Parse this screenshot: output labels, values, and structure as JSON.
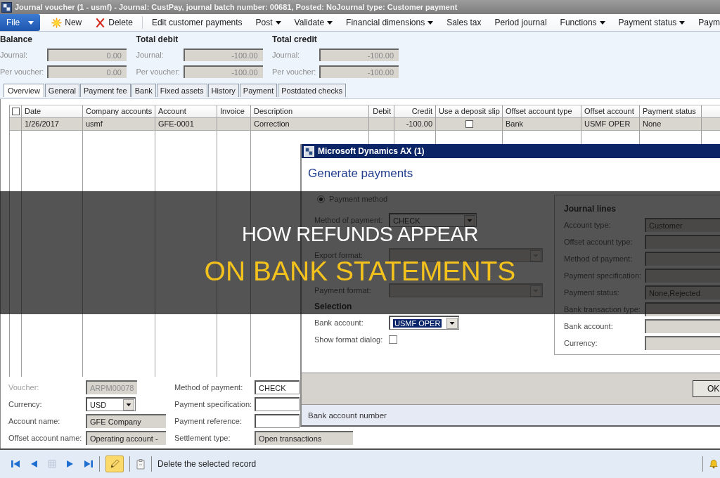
{
  "window": {
    "title": "Journal voucher (1 - usmf) - Journal: CustPay, journal batch number: 00681, Posted: NoJournal type: Customer payment"
  },
  "toolbar": [
    {
      "kind": "file",
      "label": "File"
    },
    {
      "kind": "new",
      "label": "New"
    },
    {
      "kind": "delete",
      "label": "Delete"
    },
    {
      "kind": "plain",
      "label": "Edit customer payments"
    },
    {
      "kind": "menu",
      "label": "Post"
    },
    {
      "kind": "menu",
      "label": "Validate"
    },
    {
      "kind": "menu",
      "label": "Financial dimensions"
    },
    {
      "kind": "plain",
      "label": "Sales tax"
    },
    {
      "kind": "plain",
      "label": "Period journal"
    },
    {
      "kind": "menu",
      "label": "Functions"
    },
    {
      "kind": "menu",
      "label": "Payment status"
    },
    {
      "kind": "plain",
      "label": "Paym"
    }
  ],
  "totals": [
    {
      "heading": "Balance",
      "rows": [
        {
          "label": "Journal:",
          "value": "0.00"
        },
        {
          "label": "Per voucher:",
          "value": "0.00"
        }
      ]
    },
    {
      "heading": "Total debit",
      "rows": [
        {
          "label": "Journal:",
          "value": "-100.00"
        },
        {
          "label": "Per voucher:",
          "value": "-100.00"
        }
      ]
    },
    {
      "heading": "Total credit",
      "rows": [
        {
          "label": "Journal:",
          "value": "-100.00"
        },
        {
          "label": "Per voucher:",
          "value": "-100.00"
        }
      ]
    }
  ],
  "tabs": [
    {
      "label": "Overview",
      "selected": true
    },
    {
      "label": "General",
      "selected": false
    },
    {
      "label": "Payment fee",
      "selected": false
    },
    {
      "label": "Bank",
      "selected": false
    },
    {
      "label": "Fixed assets",
      "selected": false
    },
    {
      "label": "History",
      "selected": false
    },
    {
      "label": "Payment",
      "selected": false
    },
    {
      "label": "Postdated checks",
      "selected": false
    }
  ],
  "grid": {
    "select_all_checked": false,
    "columns": [
      {
        "label": "Date",
        "kind": "text"
      },
      {
        "label": "Company accounts",
        "kind": "text"
      },
      {
        "label": "Account",
        "kind": "text"
      },
      {
        "label": "Invoice",
        "kind": "text"
      },
      {
        "label": "Description",
        "kind": "text"
      },
      {
        "label": "Debit",
        "kind": "amount"
      },
      {
        "label": "Credit",
        "kind": "amount"
      },
      {
        "label": "Use a deposit slip",
        "kind": "checkbox"
      },
      {
        "label": "Offset account type",
        "kind": "text"
      },
      {
        "label": "Offset account",
        "kind": "text"
      },
      {
        "label": "Payment status",
        "kind": "text"
      }
    ],
    "rows": [
      {
        "selected": true,
        "cells": [
          {
            "text": "1/26/2017"
          },
          {
            "text": "usmf"
          },
          {
            "text": "GFE-0001"
          },
          {},
          {
            "text": "Correction"
          },
          {},
          {
            "text": "-100.00"
          },
          {
            "checked": false
          },
          {
            "text": "Bank"
          },
          {
            "text": "USMF OPER"
          },
          {
            "text": "None"
          }
        ]
      }
    ]
  },
  "details": {
    "left": [
      {
        "label": "Voucher:",
        "kind": "readonly",
        "value": "ARPM00078",
        "disabled": true
      },
      {
        "label": "Currency:",
        "kind": "dropdown",
        "value": "USD",
        "disabled": false
      },
      {
        "label": "Account name:",
        "kind": "readonly",
        "value": "GFE Company",
        "disabled": false
      },
      {
        "label": "Offset account name:",
        "kind": "readonly",
        "value": "Operating account -",
        "disabled": false
      }
    ],
    "right": [
      {
        "label": "Method of payment:",
        "kind": "input",
        "value": "CHECK",
        "disabled": false
      },
      {
        "label": "Payment specification:",
        "kind": "input",
        "disabled": false
      },
      {
        "label": "Payment reference:",
        "kind": "input",
        "disabled": false
      },
      {
        "label": "Settlement type:",
        "kind": "readonly",
        "value": "Open transactions",
        "disabled": false
      }
    ]
  },
  "status_bar": {
    "edit_mode": true,
    "message": "Delete the selected record"
  },
  "dialog": {
    "title": "Microsoft Dynamics AX (1)",
    "heading": "Generate payments",
    "options": [
      {
        "kind": "radio",
        "label": "Payment method",
        "selected": true
      },
      {
        "kind": "dropdown",
        "label": "Method of payment:",
        "value": "CHECK",
        "disabled": false,
        "text_selected": false
      },
      {
        "kind": "dropdown",
        "label": "Export format:",
        "disabled": true,
        "text_selected": false
      },
      {
        "kind": "dropdown",
        "label": "Payment format:",
        "disabled": true,
        "text_selected": false
      },
      {
        "kind": "heading",
        "label": "Selection"
      },
      {
        "kind": "dropdown",
        "label": "Bank account:",
        "value": "USMF OPER",
        "disabled": false,
        "text_selected": true
      },
      {
        "kind": "checkbox",
        "label": "Show format dialog:",
        "checked": false
      }
    ],
    "journal_lines": {
      "heading": "Journal lines",
      "rows": [
        {
          "label": "Account type:",
          "value": "Customer"
        },
        {
          "label": "Offset account type:"
        },
        {
          "label": "Method of payment:"
        },
        {
          "label": "Payment specification:"
        },
        {
          "label": "Payment status:",
          "value": "None,Rejected"
        },
        {
          "label": "Bank transaction type:"
        },
        {
          "label": "Bank account:"
        },
        {
          "label": "Currency:"
        }
      ]
    },
    "buttons": [
      {
        "label": "OK"
      }
    ],
    "status": "Bank account number"
  },
  "title_banner": {
    "lines": [
      {
        "text": "HOW REFUNDS APPEAR",
        "color": "#ffffff"
      },
      {
        "text": "ON BANK STATEMENTS",
        "color": "#f4c21d"
      }
    ]
  }
}
